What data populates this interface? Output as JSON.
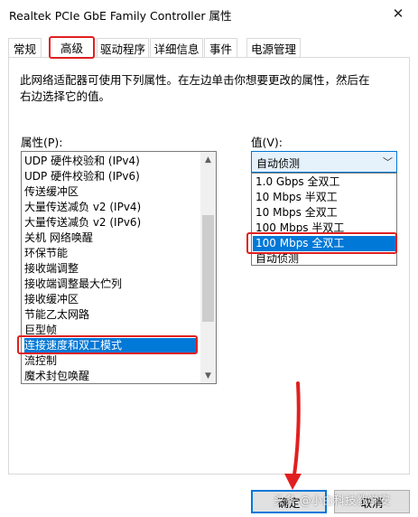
{
  "window": {
    "title": "Realtek PCIe GbE Family Controller 属性",
    "close_glyph": "✕"
  },
  "tabs": [
    {
      "label": "常规"
    },
    {
      "label": "高级"
    },
    {
      "label": "驱动程序"
    },
    {
      "label": "详细信息"
    },
    {
      "label": "事件"
    },
    {
      "label": "电源管理"
    }
  ],
  "advanced": {
    "description": "此网络适配器可使用下列属性。在左边单击你想要更改的属性，然后在右边选择它的值。",
    "property_label": "属性(P):",
    "value_label": "值(V):",
    "properties": [
      "UDP 硬件校验和 (IPv4)",
      "UDP 硬件校验和 (IPv6)",
      "传送缓冲区",
      "大量传送减负 v2 (IPv4)",
      "大量传送减负 v2 (IPv6)",
      "关机 网络唤醒",
      "环保节能",
      "接收端调整",
      "接收端调整最大伫列",
      "接收缓冲区",
      "节能乙太网路",
      "巨型帧",
      "连接速度和双工模式",
      "流控制",
      "魔术封包唤醒"
    ],
    "selected_property": "连接速度和双工模式",
    "combo_value": "自动侦测",
    "value_options": [
      "1.0 Gbps 全双工",
      "10 Mbps 半双工",
      "10 Mbps 全双工",
      "100 Mbps 半双工",
      "100 Mbps 全双工",
      "自动侦测"
    ],
    "highlighted_option": "100 Mbps 全双工"
  },
  "buttons": {
    "ok": "确定",
    "cancel": "取消"
  },
  "watermark": "头条 @小白科技教学安"
}
